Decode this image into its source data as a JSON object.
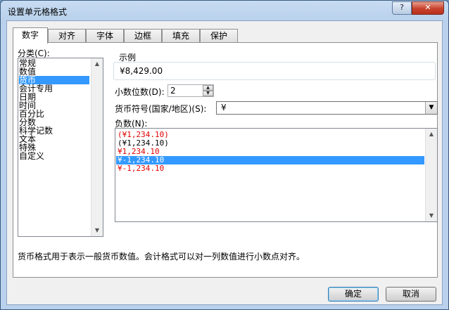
{
  "window": {
    "title": "设置单元格格式",
    "help_label": "?",
    "close_label": "✕"
  },
  "tabs": [
    {
      "label": "数字",
      "active": true
    },
    {
      "label": "对齐",
      "active": false
    },
    {
      "label": "字体",
      "active": false
    },
    {
      "label": "边框",
      "active": false
    },
    {
      "label": "填充",
      "active": false
    },
    {
      "label": "保护",
      "active": false
    }
  ],
  "category": {
    "label": "分类(C):",
    "items": [
      "常规",
      "数值",
      "货币",
      "会计专用",
      "日期",
      "时间",
      "百分比",
      "分数",
      "科学记数",
      "文本",
      "特殊",
      "自定义"
    ],
    "selected_index": 2
  },
  "sample": {
    "label": "示例",
    "value": "¥8,429.00"
  },
  "decimal": {
    "label": "小数位数(D):",
    "value": "2"
  },
  "currency": {
    "label": "货币符号(国家/地区)(S):",
    "value": "¥"
  },
  "negative": {
    "label": "负数(N):",
    "items": [
      {
        "text": "(¥1,234.10)",
        "red": true
      },
      {
        "text": "(¥1,234.10)",
        "red": false
      },
      {
        "text": "¥1,234.10",
        "red": true
      },
      {
        "text": "¥-1,234.10",
        "red": false
      },
      {
        "text": "¥-1,234.10",
        "red": true
      }
    ],
    "selected_index": 3
  },
  "description": "货币格式用于表示一般货币数值。会计格式可以对一列数值进行小数点对齐。",
  "buttons": {
    "ok": "确定",
    "cancel": "取消"
  },
  "icons": {
    "scroll_up": "▲",
    "scroll_down": "▼",
    "combo_arrow": "▼"
  },
  "colors": {
    "selection": "#3399ff",
    "negative_red": "#e00000"
  }
}
